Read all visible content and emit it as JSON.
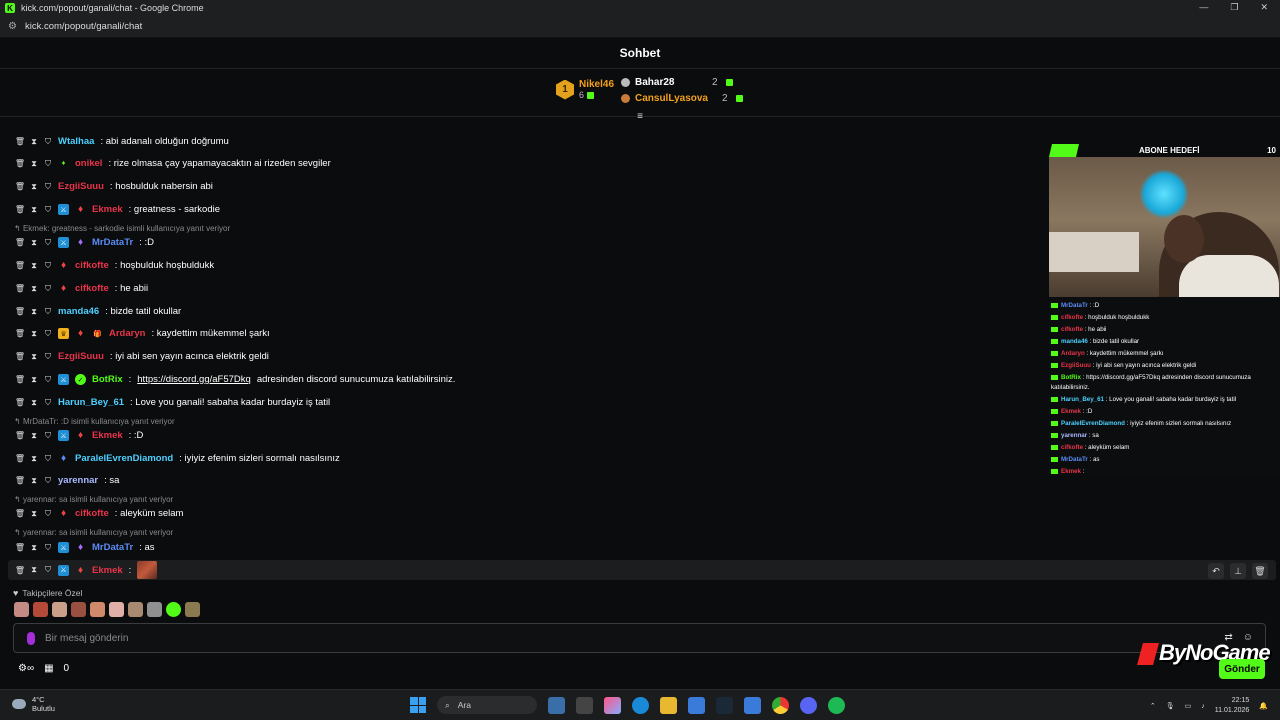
{
  "window": {
    "title": "kick.com/popout/ganali/chat - Google Chrome",
    "url": "kick.com/popout/ganali/chat"
  },
  "chat": {
    "header": "Sohbet"
  },
  "leaderboard": {
    "first": {
      "rank": "1",
      "name": "Nikel46",
      "count": "6"
    },
    "second": {
      "name": "Bahar28",
      "count": "2"
    },
    "third": {
      "name": "CansulLyasova",
      "count": "2"
    }
  },
  "colors": {
    "accent": "#53fc18",
    "mod_name": "#4dd0ff",
    "red_name": "#e8344a",
    "blue_name": "#5b8cf7",
    "green_name": "#53fc18",
    "gold": "#f2a01e"
  },
  "messages": [
    {
      "user": "Wtalhaa",
      "text": ": abi adanalı olduğun doğrumu"
    },
    {
      "user": "onikel",
      "text": ": rize olmasa çay yapamayacaktın ai rizeden sevgiler"
    },
    {
      "user": "EzgiiSuuu",
      "text": ": hosbulduk nabersin abi"
    },
    {
      "user": "Ekmek",
      "text": ": greatness - sarkodie"
    },
    {
      "reply": "Ekmek: greatness - sarkodie isimli kullanıcıya yanıt veriyor"
    },
    {
      "user": "MrDataTr",
      "text": ": :D"
    },
    {
      "user": "cifkofte",
      "text": ": hoşbulduk hoşbuldukk"
    },
    {
      "user": "cifkofte",
      "text": ": he abii"
    },
    {
      "user": "manda46",
      "text": ": bizde tatil okullar"
    },
    {
      "user": "Ardaryn",
      "text": ": kaydettim mükemmel şarkı"
    },
    {
      "user": "EzgiiSuuu",
      "text": ": iyi abi sen yayın acınca elektrik geldi"
    },
    {
      "user": "BotRix",
      "text": ":",
      "link": "https://discord.gg/aF57Dkq",
      "text2": "adresinden discord sunucumuza katılabilirsiniz."
    },
    {
      "user": "Harun_Bey_61",
      "text": ": Love you ganali! sabaha kadar burdayiz iş tatil"
    },
    {
      "reply": "MrDataTr: :D isimli kullanıcıya yanıt veriyor"
    },
    {
      "user": "Ekmek",
      "text": ": :D"
    },
    {
      "user": "ParalelEvrenDiamond",
      "text": ": iyiyiz efenim sizleri sormalı nasılsınız"
    },
    {
      "user": "yarennar",
      "text": ": sa"
    },
    {
      "reply": "yarennar: sa isimli kullanıcıya yanıt veriyor"
    },
    {
      "user": "cifkofte",
      "text": ": aleyküm selam"
    },
    {
      "reply": "yarennar: sa isimli kullanıcıya yanıt veriyor"
    },
    {
      "user": "MrDataTr",
      "text": ": as"
    },
    {
      "user": "Ekmek",
      "text": ":"
    }
  ],
  "followers_label": "Takipçilere Özel",
  "input": {
    "placeholder": "Bir mesaj gönderin"
  },
  "bottom": {
    "count": "0",
    "send": "Gönder"
  },
  "watermark": "ByNoGame",
  "overlay": {
    "goal_title": "ABONE HEDEFİ",
    "goal_count": "10",
    "messages": [
      {
        "user": "MrDataTr",
        "text": " : :D"
      },
      {
        "user": "cifkofte",
        "text": " : hoşbulduk hoşbuldukk"
      },
      {
        "user": "cifkofte",
        "text": " : he abii"
      },
      {
        "user": "manda46",
        "text": " : bizde tatil okullar"
      },
      {
        "user": "Ardaryn",
        "text": " : kaydettim mükemmel şarkı"
      },
      {
        "user": "EzgiiSuuu",
        "text": " : iyi abi sen yayın acınca elektrik geldi"
      },
      {
        "user": "BotRix",
        "text": " : https://discord.gg/aF57Dkq adresinden discord sunucumuza"
      },
      {
        "user": "",
        "text": "katılabilirsiniz."
      },
      {
        "user": "Harun_Bey_61",
        "text": " : Love you ganali! sabaha kadar burdayiz iş tatil"
      },
      {
        "user": "Ekmek",
        "text": " : :D"
      },
      {
        "user": "ParalelEvrenDiamond",
        "text": " : iyiyiz efenim sizleri sormalı nasılsınız"
      },
      {
        "user": "yarennar",
        "text": " : sa"
      },
      {
        "user": "cifkofte",
        "text": " : aleyküm selam"
      },
      {
        "user": "MrDataTr",
        "text": " : as"
      },
      {
        "user": "Ekmek",
        "text": " :"
      }
    ]
  },
  "taskbar": {
    "temp": "4°C",
    "condition": "Bulutlu",
    "search": "Ara",
    "time": "22:15",
    "date": "11.01.2026",
    "notif": "6"
  }
}
